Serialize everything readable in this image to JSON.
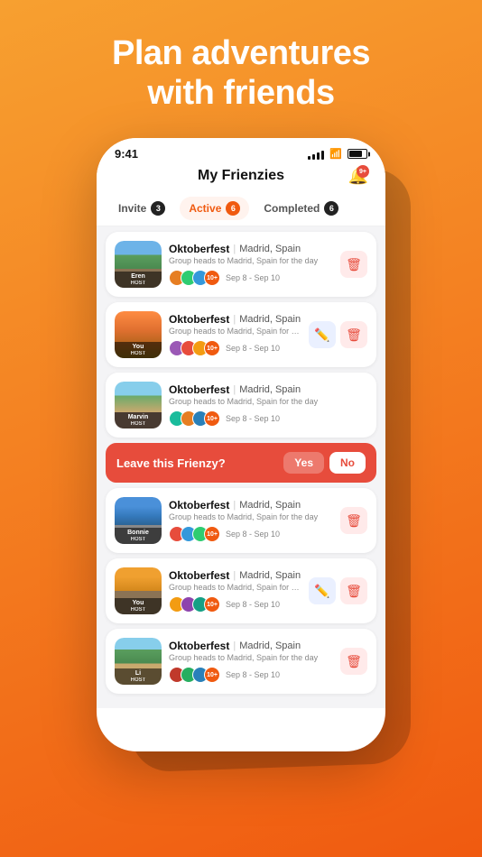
{
  "headline": {
    "line1": "Plan adventures",
    "line2": "with friends"
  },
  "status_bar": {
    "time": "9:41",
    "notif_count": "9+"
  },
  "header": {
    "title": "My Frienzies",
    "bell_label": "bell-icon"
  },
  "tabs": [
    {
      "id": "invite",
      "label": "Invite",
      "count": "3",
      "active": false
    },
    {
      "id": "active",
      "label": "Active",
      "count": "6",
      "active": true
    },
    {
      "id": "completed",
      "label": "Completed",
      "count": "6",
      "active": false
    }
  ],
  "cards": [
    {
      "id": 1,
      "event": "Oktoberfest",
      "location": "Madrid, Spain",
      "desc": "Group heads to Madrid, Spain for the day",
      "host_label": "Eren",
      "host_tag": "HOST",
      "dates": "Sep 8 - Sep 10",
      "landscape_class": "landscape",
      "actions": [
        "delete"
      ]
    },
    {
      "id": 2,
      "event": "Oktoberfest",
      "location": "Madrid, Spain",
      "desc": "Group heads to Madrid, Spain for the day",
      "host_label": "You",
      "host_tag": "HOST",
      "dates": "Sep 8 - Sep 10",
      "landscape_class": "landscape landscape-2",
      "actions": [
        "edit",
        "delete"
      ]
    },
    {
      "id": 3,
      "event": "Oktoberfest",
      "location": "Madrid, Spain",
      "desc": "Group heads to Madrid, Spain for the day",
      "host_label": "Marvin",
      "host_tag": "HOST",
      "dates": "Sep 8 - Sep 10",
      "landscape_class": "landscape landscape-3",
      "actions": []
    },
    {
      "id": 4,
      "event": "Oktoberfest",
      "location": "Madrid, Spain",
      "desc": "Group heads to Madrid, Spain for the day",
      "host_label": "Bonnie",
      "host_tag": "HOST",
      "dates": "Sep 8 - Sep 10",
      "landscape_class": "landscape landscape-4",
      "actions": [
        "delete"
      ]
    },
    {
      "id": 5,
      "event": "Oktoberfest",
      "location": "Madrid, Spain",
      "desc": "Group heads to Madrid, Spain for the day",
      "host_label": "You",
      "host_tag": "HOST",
      "dates": "Sep 8 - Sep 10",
      "landscape_class": "landscape landscape-5",
      "actions": [
        "edit",
        "delete"
      ]
    },
    {
      "id": 6,
      "event": "Oktoberfest",
      "location": "Madrid, Spain",
      "desc": "Group heads to Madrid, Spain for the day",
      "host_label": "Li",
      "host_tag": "HOST",
      "dates": "Sep 8 - Sep 10",
      "landscape_class": "landscape landscape-6",
      "actions": [
        "delete"
      ]
    }
  ],
  "leave_banner": {
    "text": "Leave this Frienzy?",
    "yes_label": "Yes",
    "no_label": "No"
  },
  "leave_after_card_index": 2,
  "avatar_colors": [
    "#e67e22",
    "#2ecc71",
    "#3498db",
    "#9b59b6",
    "#e74c3c"
  ],
  "more_count": "10+"
}
